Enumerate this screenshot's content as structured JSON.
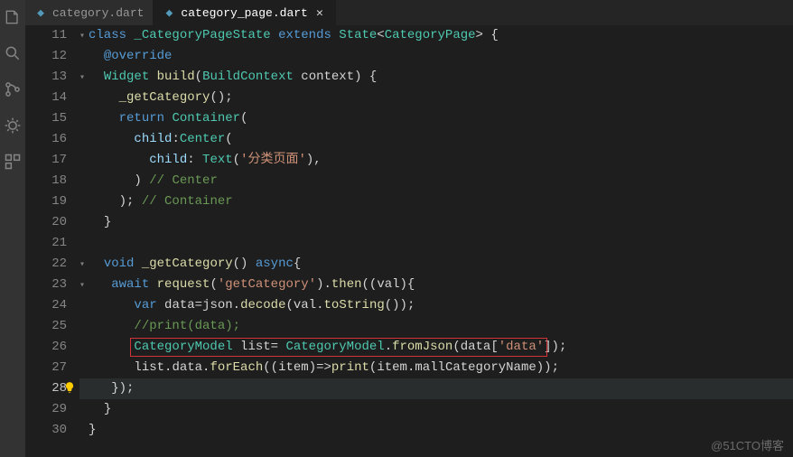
{
  "tabs": [
    {
      "label": "category.dart",
      "active": false
    },
    {
      "label": "category_page.dart",
      "active": true
    }
  ],
  "lineStart": 11,
  "lineEnd": 30,
  "currentLine": 28,
  "code": {
    "l11": {
      "indent": "",
      "tokens": [
        [
          "kw",
          "class"
        ],
        [
          "plain",
          " "
        ],
        [
          "type",
          "_CategoryPageState"
        ],
        [
          "plain",
          " "
        ],
        [
          "kw",
          "extends"
        ],
        [
          "plain",
          " "
        ],
        [
          "type",
          "State"
        ],
        [
          "punc",
          "<"
        ],
        [
          "type",
          "CategoryPage"
        ],
        [
          "punc",
          ">"
        ],
        [
          "plain",
          " {"
        ]
      ]
    },
    "l12": {
      "indent": "  ",
      "tokens": [
        [
          "an",
          "@override"
        ]
      ]
    },
    "l13": {
      "indent": "  ",
      "tokens": [
        [
          "type",
          "Widget"
        ],
        [
          "plain",
          " "
        ],
        [
          "fn",
          "build"
        ],
        [
          "punc",
          "("
        ],
        [
          "type",
          "BuildContext"
        ],
        [
          "plain",
          " context"
        ],
        [
          "punc",
          ")"
        ],
        [
          "plain",
          " {"
        ]
      ]
    },
    "l14": {
      "indent": "    ",
      "tokens": [
        [
          "fn",
          "_getCategory"
        ],
        [
          "punc",
          "();"
        ]
      ]
    },
    "l15": {
      "indent": "    ",
      "tokens": [
        [
          "kw",
          "return"
        ],
        [
          "plain",
          " "
        ],
        [
          "type",
          "Container"
        ],
        [
          "punc",
          "("
        ]
      ]
    },
    "l16": {
      "indent": "      ",
      "tokens": [
        [
          "prop",
          "child"
        ],
        [
          "punc",
          ":"
        ],
        [
          "type",
          "Center"
        ],
        [
          "punc",
          "("
        ]
      ]
    },
    "l17": {
      "indent": "        ",
      "tokens": [
        [
          "prop",
          "child"
        ],
        [
          "punc",
          ": "
        ],
        [
          "type",
          "Text"
        ],
        [
          "punc",
          "("
        ],
        [
          "str",
          "'分类页面'"
        ],
        [
          "punc",
          "),"
        ]
      ]
    },
    "l18": {
      "indent": "      ",
      "tokens": [
        [
          "punc",
          ") "
        ],
        [
          "cmt",
          "// Center"
        ]
      ]
    },
    "l19": {
      "indent": "    ",
      "tokens": [
        [
          "punc",
          "); "
        ],
        [
          "cmt",
          "// Container"
        ]
      ]
    },
    "l20": {
      "indent": "  ",
      "tokens": [
        [
          "punc",
          "}"
        ]
      ]
    },
    "l21": {
      "indent": "",
      "tokens": []
    },
    "l22": {
      "indent": "  ",
      "tokens": [
        [
          "kw",
          "void"
        ],
        [
          "plain",
          " "
        ],
        [
          "fn",
          "_getCategory"
        ],
        [
          "punc",
          "() "
        ],
        [
          "kw",
          "async"
        ],
        [
          "punc",
          "{"
        ]
      ]
    },
    "l23": {
      "indent": "   ",
      "tokens": [
        [
          "kw",
          "await"
        ],
        [
          "plain",
          " "
        ],
        [
          "fn",
          "request"
        ],
        [
          "punc",
          "("
        ],
        [
          "str",
          "'getCategory'"
        ],
        [
          "punc",
          ")."
        ],
        [
          "fn",
          "then"
        ],
        [
          "punc",
          "(("
        ],
        [
          "plain",
          "val"
        ],
        [
          "punc",
          "){"
        ]
      ]
    },
    "l24": {
      "indent": "      ",
      "tokens": [
        [
          "kw",
          "var"
        ],
        [
          "plain",
          " data"
        ],
        [
          "punc",
          "="
        ],
        [
          "plain",
          "json"
        ],
        [
          "punc",
          "."
        ],
        [
          "fn",
          "decode"
        ],
        [
          "punc",
          "("
        ],
        [
          "plain",
          "val"
        ],
        [
          "punc",
          "."
        ],
        [
          "fn",
          "toString"
        ],
        [
          "punc",
          "());"
        ]
      ]
    },
    "l25": {
      "indent": "      ",
      "tokens": [
        [
          "cmt",
          "//print(data);"
        ]
      ]
    },
    "l26": {
      "indent": "      ",
      "tokens": [
        [
          "type",
          "CategoryModel"
        ],
        [
          "plain",
          " list"
        ],
        [
          "punc",
          "= "
        ],
        [
          "type",
          "CategoryModel"
        ],
        [
          "punc",
          "."
        ],
        [
          "fn",
          "fromJson"
        ],
        [
          "punc",
          "("
        ],
        [
          "plain",
          "data"
        ],
        [
          "punc",
          "["
        ],
        [
          "str",
          "'data'"
        ],
        [
          "punc",
          "]);"
        ]
      ]
    },
    "l27": {
      "indent": "      ",
      "tokens": [
        [
          "plain",
          "list"
        ],
        [
          "punc",
          "."
        ],
        [
          "plain",
          "data"
        ],
        [
          "punc",
          "."
        ],
        [
          "fn",
          "forEach"
        ],
        [
          "punc",
          "(("
        ],
        [
          "plain",
          "item"
        ],
        [
          "punc",
          ")=>"
        ],
        [
          "fn",
          "print"
        ],
        [
          "punc",
          "("
        ],
        [
          "plain",
          "item"
        ],
        [
          "punc",
          "."
        ],
        [
          "plain",
          "mallCategoryName"
        ],
        [
          "punc",
          "));"
        ]
      ]
    },
    "l28": {
      "indent": "   ",
      "tokens": [
        [
          "punc",
          "});"
        ]
      ]
    },
    "l29": {
      "indent": "  ",
      "tokens": [
        [
          "punc",
          "}"
        ]
      ]
    },
    "l30": {
      "indent": "",
      "tokens": [
        [
          "punc",
          "}"
        ]
      ]
    }
  },
  "foldableLines": [
    11,
    13,
    22,
    23
  ],
  "highlightBox": {
    "line": 26,
    "leftCh": 6,
    "widthCh": 59
  },
  "watermark": "@51CTO博客"
}
